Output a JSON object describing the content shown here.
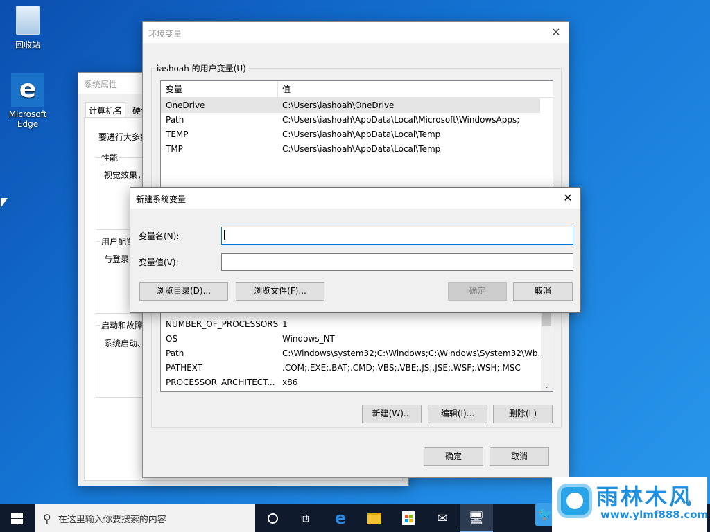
{
  "desktop": {
    "icons": [
      {
        "label": "回收站",
        "icon": "recycle-bin-icon"
      },
      {
        "label": "Microsoft Edge",
        "icon": "edge-icon"
      }
    ]
  },
  "sysprops": {
    "title": "系统属性",
    "tabs": [
      "计算机名",
      "硬件"
    ],
    "intro": "要进行大多数",
    "groups": [
      {
        "label": "性能",
        "text": "视觉效果，"
      },
      {
        "label": "用户配置",
        "text": "与登录"
      },
      {
        "label": "启动和故障",
        "text": "系统启动、"
      }
    ]
  },
  "envvars": {
    "title": "环境变量",
    "user_group": "iashoah 的用户变量(U)",
    "user_headers": [
      "变量",
      "值"
    ],
    "user_rows": [
      {
        "name": "OneDrive",
        "value": "C:\\Users\\iashoah\\OneDrive"
      },
      {
        "name": "Path",
        "value": "C:\\Users\\iashoah\\AppData\\Local\\Microsoft\\WindowsApps;"
      },
      {
        "name": "TEMP",
        "value": "C:\\Users\\iashoah\\AppData\\Local\\Temp"
      },
      {
        "name": "TMP",
        "value": "C:\\Users\\iashoah\\AppData\\Local\\Temp"
      }
    ],
    "sys_rows": [
      {
        "name": "NUMBER_OF_PROCESSORS",
        "value": "1"
      },
      {
        "name": "OS",
        "value": "Windows_NT"
      },
      {
        "name": "Path",
        "value": "C:\\Windows\\system32;C:\\Windows;C:\\Windows\\System32\\Wb..."
      },
      {
        "name": "PATHEXT",
        "value": ".COM;.EXE;.BAT;.CMD;.VBS;.VBE;.JS;.JSE;.WSF;.WSH;.MSC"
      },
      {
        "name": "PROCESSOR_ARCHITECT...",
        "value": "x86"
      }
    ],
    "sys_buttons": {
      "new": "新建(W)...",
      "edit": "编辑(I)...",
      "delete": "删除(L)"
    },
    "ok": "确定",
    "cancel": "取消"
  },
  "dialog": {
    "title": "新建系统变量",
    "name_label": "变量名(N):",
    "value_label": "变量值(V):",
    "name_value": "",
    "value_value": "",
    "browse_dir": "浏览目录(D)...",
    "browse_file": "浏览文件(F)...",
    "ok": "确定",
    "cancel": "取消"
  },
  "taskbar": {
    "search_placeholder": "在这里输入你要搜索的内容",
    "icons": [
      "cortana-icon",
      "task-view-icon",
      "edge-icon",
      "file-explorer-icon",
      "store-icon",
      "mail-icon",
      "system-properties-icon"
    ]
  },
  "watermark": {
    "brand": "雨林木风",
    "url": "www.ylmf888.com"
  }
}
